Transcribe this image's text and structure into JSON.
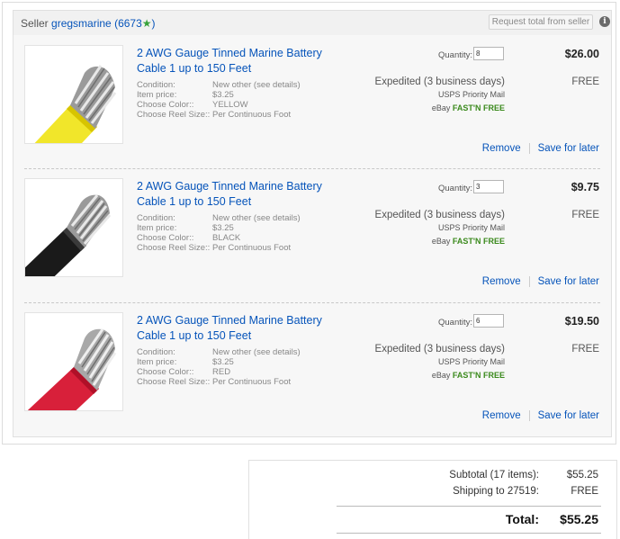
{
  "seller": {
    "prefix": "Seller",
    "name": "gregsmarine",
    "feedback": "(6673",
    "star": "★",
    "suffix": ")",
    "request_total": "Request total from seller",
    "info_icon": "i"
  },
  "items": [
    {
      "title": "2 AWG Gauge Tinned Marine Battery Cable 1 up to 150 Feet",
      "attrs": [
        {
          "k": "Condition:",
          "v": "New other (see details)"
        },
        {
          "k": "Item price:",
          "v": "$3.25"
        },
        {
          "k": "Choose Color::",
          "v": "YELLOW"
        },
        {
          "k": "Choose Reel Size::",
          "v": "Per Continuous Foot"
        }
      ],
      "qty_label": "Quantity:",
      "qty": "8",
      "price": "$26.00",
      "ship_name": "Expedited (3 business days)",
      "ship_cost": "FREE",
      "carrier": "USPS Priority Mail",
      "badge_prefix": "eBay",
      "badge": "FAST'N FREE",
      "remove": "Remove",
      "save": "Save for later",
      "color": "#f1e62a"
    },
    {
      "title": "2 AWG Gauge Tinned Marine Battery Cable 1 up to 150 Feet",
      "attrs": [
        {
          "k": "Condition:",
          "v": "New other (see details)"
        },
        {
          "k": "Item price:",
          "v": "$3.25"
        },
        {
          "k": "Choose Color::",
          "v": "BLACK"
        },
        {
          "k": "Choose Reel Size::",
          "v": "Per Continuous Foot"
        }
      ],
      "qty_label": "Quantity:",
      "qty": "3",
      "price": "$9.75",
      "ship_name": "Expedited (3 business days)",
      "ship_cost": "FREE",
      "carrier": "USPS Priority Mail",
      "badge_prefix": "eBay",
      "badge": "FAST'N FREE",
      "remove": "Remove",
      "save": "Save for later",
      "color": "#1a1a1a"
    },
    {
      "title": "2 AWG Gauge Tinned Marine Battery Cable 1 up to 150 Feet",
      "attrs": [
        {
          "k": "Condition:",
          "v": "New other (see details)"
        },
        {
          "k": "Item price:",
          "v": "$3.25"
        },
        {
          "k": "Choose Color::",
          "v": "RED"
        },
        {
          "k": "Choose Reel Size::",
          "v": "Per Continuous Foot"
        }
      ],
      "qty_label": "Quantity:",
      "qty": "6",
      "price": "$19.50",
      "ship_name": "Expedited (3 business days)",
      "ship_cost": "FREE",
      "carrier": "USPS Priority Mail",
      "badge_prefix": "eBay",
      "badge": "FAST'N FREE",
      "remove": "Remove",
      "save": "Save for later",
      "color": "#d8203a"
    }
  ],
  "summary": {
    "subtotal_label": "Subtotal (17 items):",
    "subtotal": "$55.25",
    "shipping_label": "Shipping to 27519:",
    "shipping": "FREE",
    "total_label": "Total:",
    "total": "$55.25"
  }
}
